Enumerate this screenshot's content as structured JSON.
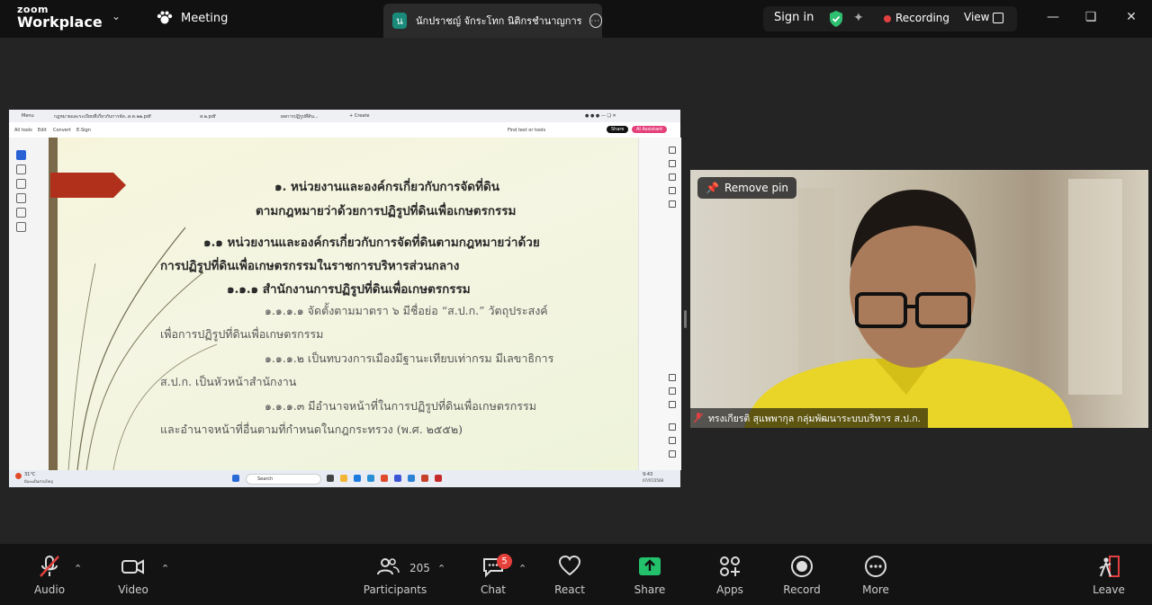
{
  "app": {
    "brand_top": "zoom",
    "brand_name": "Workplace"
  },
  "top": {
    "meeting_label": "Meeting",
    "tab_avatar": "น",
    "tab_name": "นักปราชญ์ จักระโทก นิติกรชำนาญการ",
    "sign_in": "Sign in",
    "recording": "Recording",
    "view": "View"
  },
  "shared": {
    "browser_tabs": [
      "Menu",
      "กฎหมายและระเบียบที่เกี่ยวกับการจัด...",
      "ส.ค.๒๒.pdf",
      "ส.๒.pdf",
      "ผลการปฏิรูปที่ดิน...",
      "+ Create"
    ],
    "pdf_toolbar": [
      "All tools",
      "Edit",
      "Convert",
      "E-Sign"
    ],
    "pdf_find": "Find text or tools",
    "pdf_share": "Share",
    "pdf_ai": "AI Assistant",
    "slide_lines": [
      "๑. หน่วยงานและองค์กรเกี่ยวกับการจัดที่ดิน",
      "ตามกฎหมายว่าด้วยการปฏิรูปที่ดินเพื่อเกษตรกรรม",
      "๑.๑ หน่วยงานและองค์กรเกี่ยวกับการจัดที่ดินตามกฎหมายว่าด้วย",
      "การปฏิรูปที่ดินเพื่อเกษตรกรรมในราชการบริหารส่วนกลาง",
      "๑.๑.๑ สำนักงานการปฏิรูปที่ดินเพื่อเกษตรกรรม",
      "๑.๑.๑.๑ จัดตั้งตามมาตรา ๖ มีชื่อย่อ “ส.ป.ก.” วัตถุประสงค์",
      "เพื่อการปฏิรูปที่ดินเพื่อเกษตรกรรม",
      "๑.๑.๑.๒ เป็นทบวงการเมืองมีฐานะเทียบเท่ากรม มีเลขาธิการ",
      "ส.ป.ก. เป็นหัวหน้าสำนักงาน",
      "๑.๑.๑.๓ มีอำนาจหน้าที่ในการปฏิรูปที่ดินเพื่อเกษตรกรรม",
      "และอำนาจหน้าที่อื่นตามที่กำหนดในกฎกระทรวง (พ.ศ. ๒๕๕๒)"
    ],
    "taskbar_weather": "31°C",
    "taskbar_weather_sub": "มีเมฆเป็นส่วนใหญ่",
    "taskbar_search": "Search",
    "taskbar_time": "9:43",
    "taskbar_date": "07/07/2568"
  },
  "video": {
    "remove_pin": "Remove pin",
    "participant_name": "ทรงเกียรติ สุแพพากุล กลุ่มพัฒนาระบบบริหาร ส.ป.ก."
  },
  "controls": {
    "audio": "Audio",
    "video": "Video",
    "participants": "Participants",
    "participants_count": "205",
    "chat": "Chat",
    "chat_badge": "5",
    "react": "React",
    "share": "Share",
    "apps": "Apps",
    "record": "Record",
    "more": "More",
    "leave": "Leave"
  },
  "colors": {
    "accent_green": "#2fbf71",
    "record_red": "#e14040",
    "share_green": "#23c16b",
    "ribbon_red": "#b0301c"
  }
}
